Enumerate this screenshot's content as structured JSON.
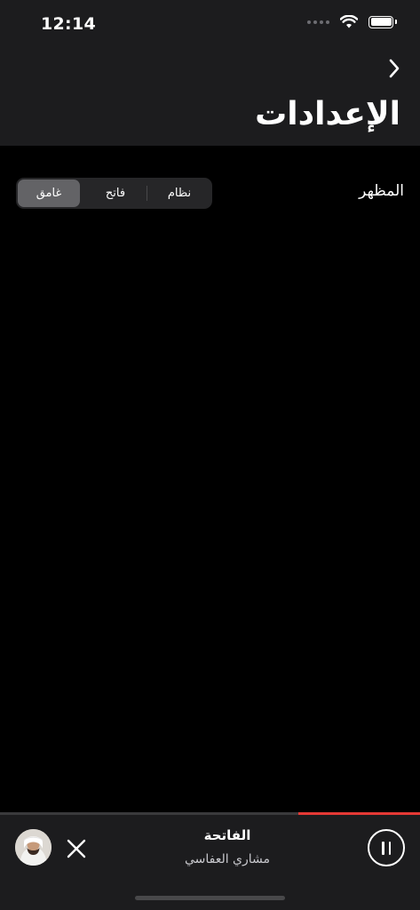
{
  "status_bar": {
    "time": "12:14",
    "icons": [
      "cellular-dots-icon",
      "wifi-icon",
      "battery-icon"
    ]
  },
  "header": {
    "back_icon": "chevron-right-icon",
    "title": "الإعدادات"
  },
  "settings": {
    "appearance_label": "المظهر",
    "options": [
      {
        "label": "نظام",
        "selected": false
      },
      {
        "label": "فاتح",
        "selected": false
      },
      {
        "label": "غامق",
        "selected": true
      }
    ]
  },
  "player": {
    "title": "الفاتحة",
    "artist": "مشاري العفاسي",
    "progress": 0.29,
    "progress_color": "#e53935",
    "close_icon": "close-icon",
    "pause_icon": "pause-icon"
  },
  "colors": {
    "background": "#000000",
    "header_background": "#1c1c1e",
    "selected_segment": "#636366",
    "accent": "#e53935"
  }
}
